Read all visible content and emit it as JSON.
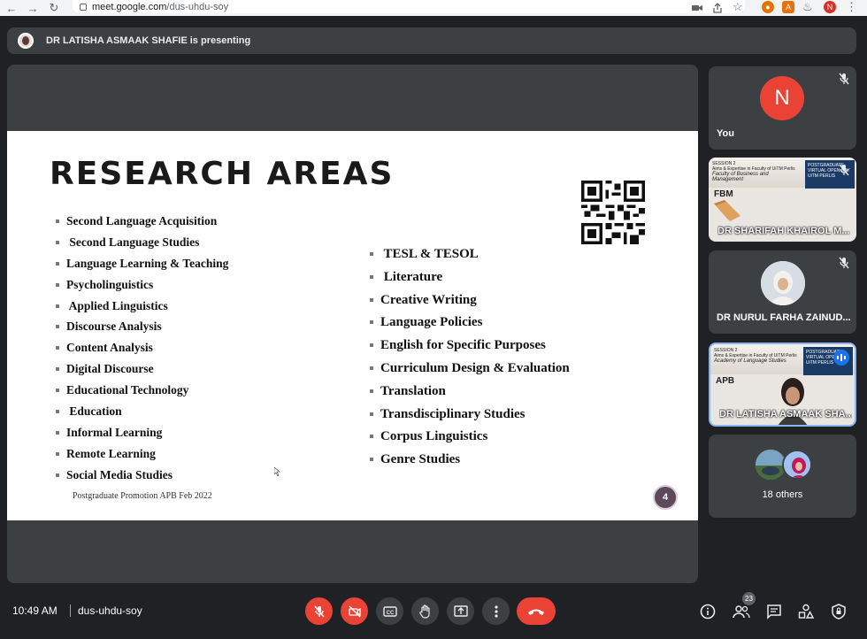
{
  "browser": {
    "url_host": "meet.google.com",
    "url_path": "/dus-uhdu-soy",
    "profile_initial": "N",
    "extension_labels": [
      "A"
    ]
  },
  "banner": {
    "text": "DR LATISHA ASMAAK SHAFIE is presenting"
  },
  "slide": {
    "title": "RESEARCH AREAS",
    "left_items": [
      "Second Language Acquisition",
      " Second Language Studies",
      "Language Learning & Teaching",
      "Psycholinguistics",
      " Applied Linguistics",
      "Discourse Analysis",
      "Content Analysis",
      "Digital Discourse",
      "Educational Technology",
      " Education",
      "Informal Learning",
      "Remote Learning",
      "Social Media Studies"
    ],
    "right_items": [
      " TESL & TESOL",
      " Literature",
      "Creative Writing",
      "Language Policies",
      "English for Specific Purposes",
      "Curriculum Design & Evaluation",
      "Translation",
      "Transdisciplinary Studies",
      "Corpus Linguistics",
      "Genre Studies"
    ],
    "footer": "Postgraduate Promotion APB Feb 2022",
    "page_number": "4"
  },
  "participants": {
    "you": {
      "initial": "N",
      "label": "You"
    },
    "tile2": {
      "name": "DR SHARIFAH KHAIROL M...",
      "tag": "FBM",
      "session": "SESSION 2",
      "line1": "Aims & Expertise in Faculty of UiTM Perlis",
      "line2": "Faculty of Business and Management",
      "badge1": "POSTGRADUATE",
      "badge2": "VIRTUAL OPEN DAY",
      "badge3": "UiTM PERLIS"
    },
    "tile3": {
      "name": "DR NURUL FARHA ZAINUD..."
    },
    "tile4": {
      "name": "DR LATISHA ASMAAK SHA...",
      "tag": "APB",
      "session": "SESSION 2",
      "line1": "Aims & Expertise in Faculty of UiTM Perlis",
      "line2": "Academy of Language Studies",
      "badge1": "POSTGRADUATE",
      "badge2": "VIRTUAL OPEN DAY",
      "badge3": "UiTM PERLIS"
    },
    "others": {
      "label": "18 others"
    }
  },
  "bottom_bar": {
    "time": "10:49 AM",
    "meeting_code": "dus-uhdu-soy",
    "people_count": "23"
  },
  "colors": {
    "background": "#202124",
    "surface": "#3c4043",
    "danger": "#ea4335",
    "highlight": "#8ab4f8"
  }
}
